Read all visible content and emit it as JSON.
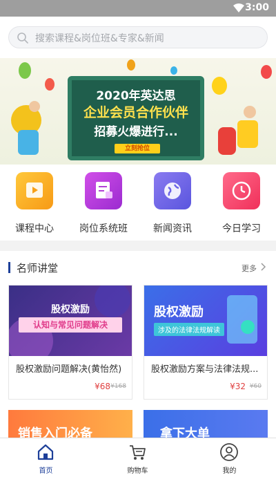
{
  "status_bar": {
    "time": "3:00"
  },
  "search": {
    "placeholder": "搜索课程&岗位班&专家&新闻"
  },
  "banner": {
    "line1": "2020年英达思",
    "line2": "企业会员合作伙伴",
    "line3": "招募火爆进行...",
    "cta": "立刻抢位"
  },
  "categories": [
    {
      "label": "课程中心",
      "icon": "play-icon",
      "color": "#f9a825"
    },
    {
      "label": "岗位系统班",
      "icon": "document-icon",
      "color": "#b23fd6"
    },
    {
      "label": "新闻资讯",
      "icon": "globe-icon",
      "color": "#6b63e8"
    },
    {
      "label": "今日学习",
      "icon": "clock-icon",
      "color": "#f5426c"
    }
  ],
  "teachers": {
    "title": "名师讲堂",
    "more": "更多",
    "courses": [
      {
        "name": "股权激励问题解决(黄怡然)",
        "price": "¥68",
        "old_price": "¥168",
        "thumb_title": "股权激励",
        "thumb_sub": "认知与常见问题解决"
      },
      {
        "name": "股权激励方案与法律法规...",
        "price": "¥32",
        "old_price": "¥60",
        "thumb_title": "股权激励",
        "thumb_sub": "涉及的法律法规解读"
      }
    ],
    "partial": [
      {
        "thumb_text": "销售入门必备"
      },
      {
        "thumb_text": "拿下大单"
      }
    ]
  },
  "tabbar": [
    {
      "label": "首页",
      "icon": "home-icon",
      "active": true
    },
    {
      "label": "购物车",
      "icon": "cart-icon",
      "active": false
    },
    {
      "label": "我的",
      "icon": "user-icon",
      "active": false
    }
  ]
}
